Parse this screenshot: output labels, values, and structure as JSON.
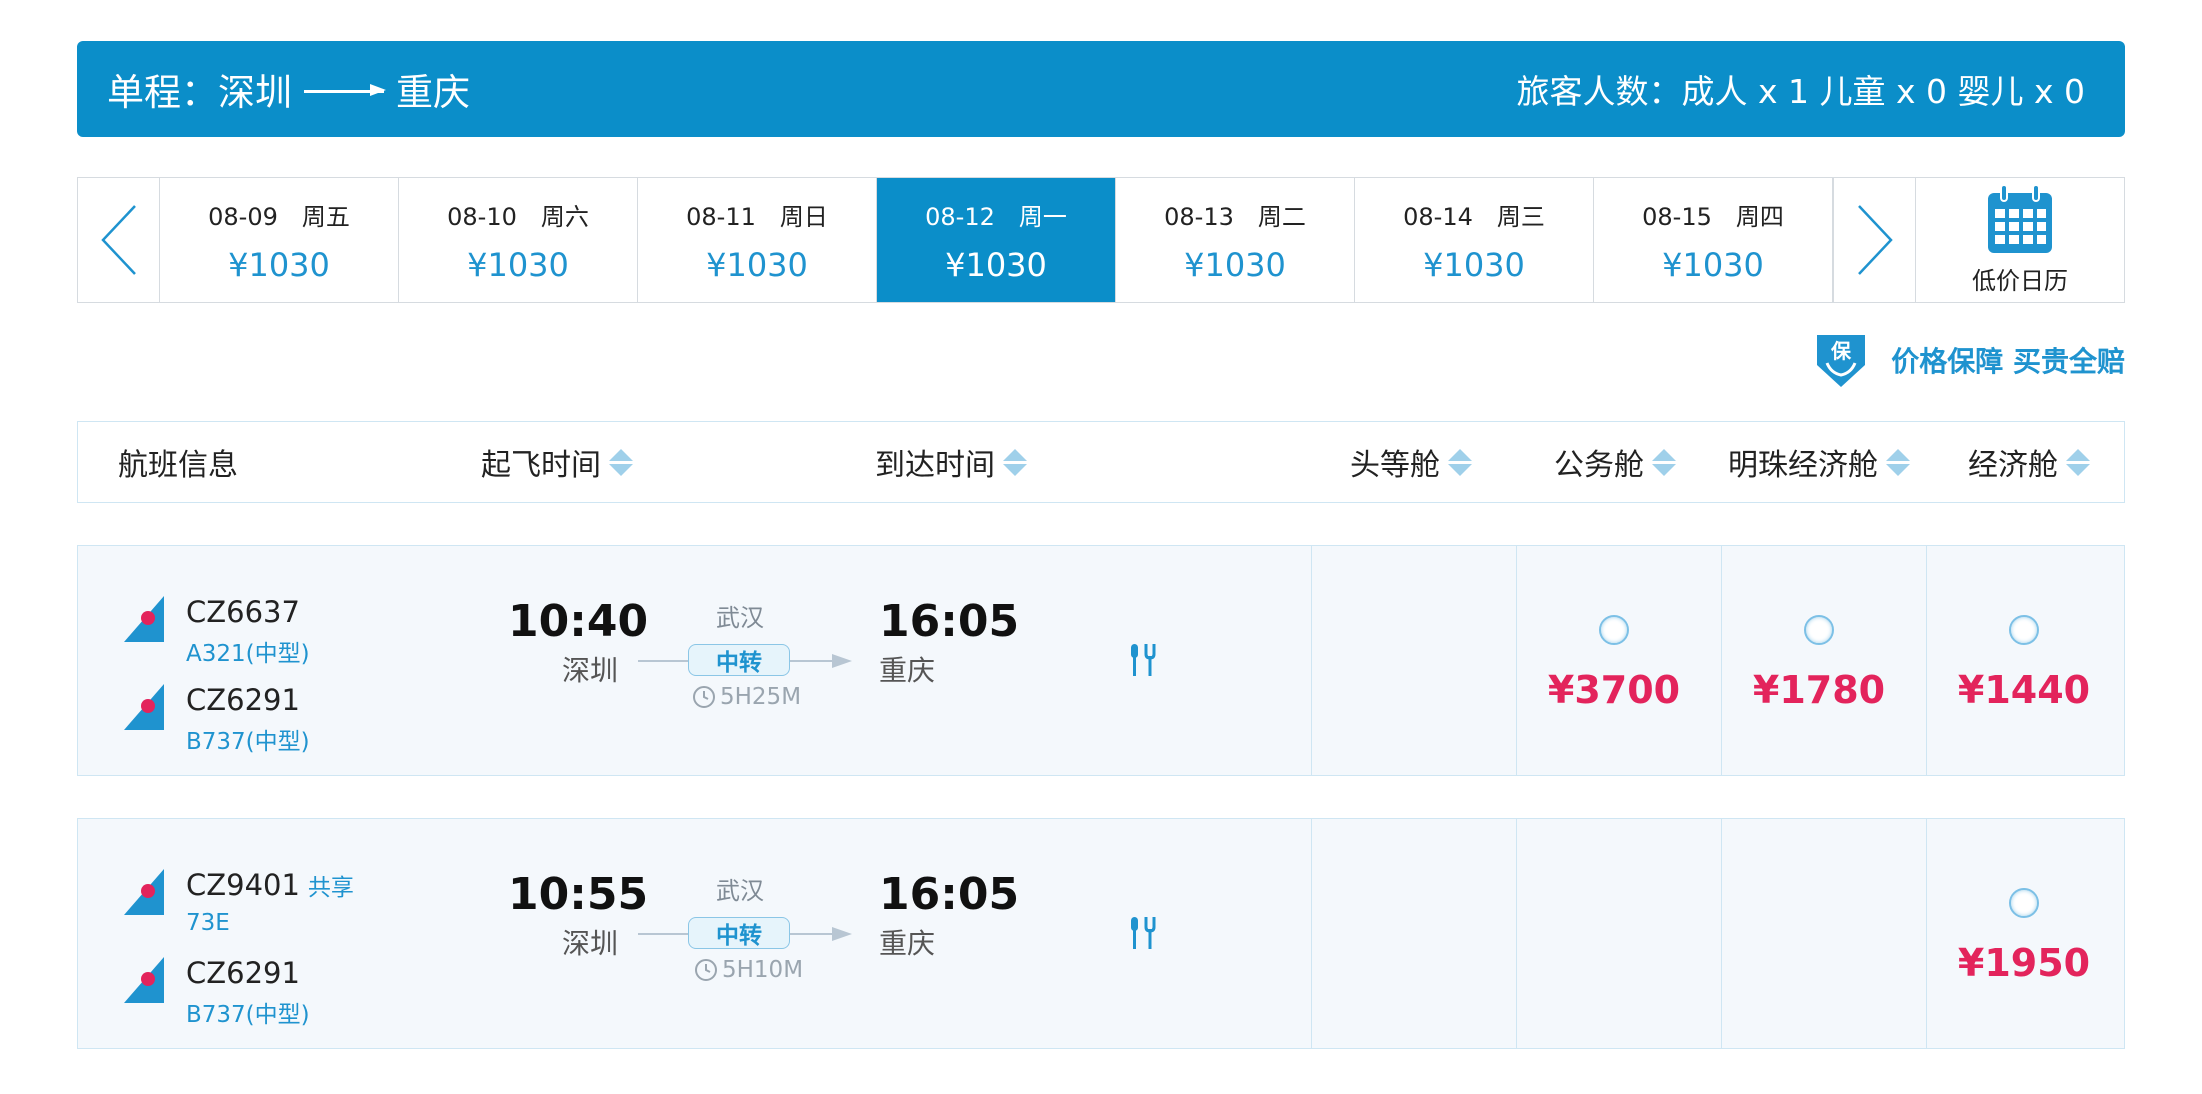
{
  "banner": {
    "trip_label": "单程：深圳",
    "to_city": "重庆",
    "passengers": "旅客人数：成人 x 1 儿童 x 0 婴儿 x 0"
  },
  "dates": [
    {
      "date": "08-09　周五",
      "price": "¥1030"
    },
    {
      "date": "08-10　周六",
      "price": "¥1030"
    },
    {
      "date": "08-11　周日",
      "price": "¥1030"
    },
    {
      "date": "08-12　周一",
      "price": "¥1030",
      "active": true
    },
    {
      "date": "08-13　周二",
      "price": "¥1030"
    },
    {
      "date": "08-14　周三",
      "price": "¥1030"
    },
    {
      "date": "08-15　周四",
      "price": "¥1030"
    }
  ],
  "calendar_label": "低价日历",
  "guarantee": {
    "icon_char": "保",
    "label": "价格保障 买贵全赔"
  },
  "header": {
    "flight_info": "航班信息",
    "depart": "起飞时间",
    "arrive": "到达时间",
    "first": "头等舱",
    "business": "公务舱",
    "pearl": "明珠经济舱",
    "economy": "经济舱"
  },
  "flights": [
    {
      "seg1_code": "CZ6637",
      "seg1_type": "A321(中型)",
      "seg1_share": "",
      "seg2_code": "CZ6291",
      "seg2_type": "B737(中型)",
      "dep_time": "10:40",
      "dep_city": "深圳",
      "via": "武汉",
      "transfer": "中转",
      "duration": "5H25M",
      "arr_time": "16:05",
      "arr_city": "重庆",
      "business_price": "¥3700",
      "pearl_price": "¥1780",
      "economy_price": "¥1440"
    },
    {
      "seg1_code": "CZ9401",
      "seg1_type": "73E",
      "seg1_share": "共享",
      "seg2_code": "CZ6291",
      "seg2_type": "B737(中型)",
      "dep_time": "10:55",
      "dep_city": "深圳",
      "via": "武汉",
      "transfer": "中转",
      "duration": "5H10M",
      "arr_time": "16:05",
      "arr_city": "重庆",
      "economy_price": "¥1950"
    }
  ],
  "colors": {
    "brand": "#0b8ec9",
    "link": "#1f93cf",
    "price": "#e3245c"
  }
}
